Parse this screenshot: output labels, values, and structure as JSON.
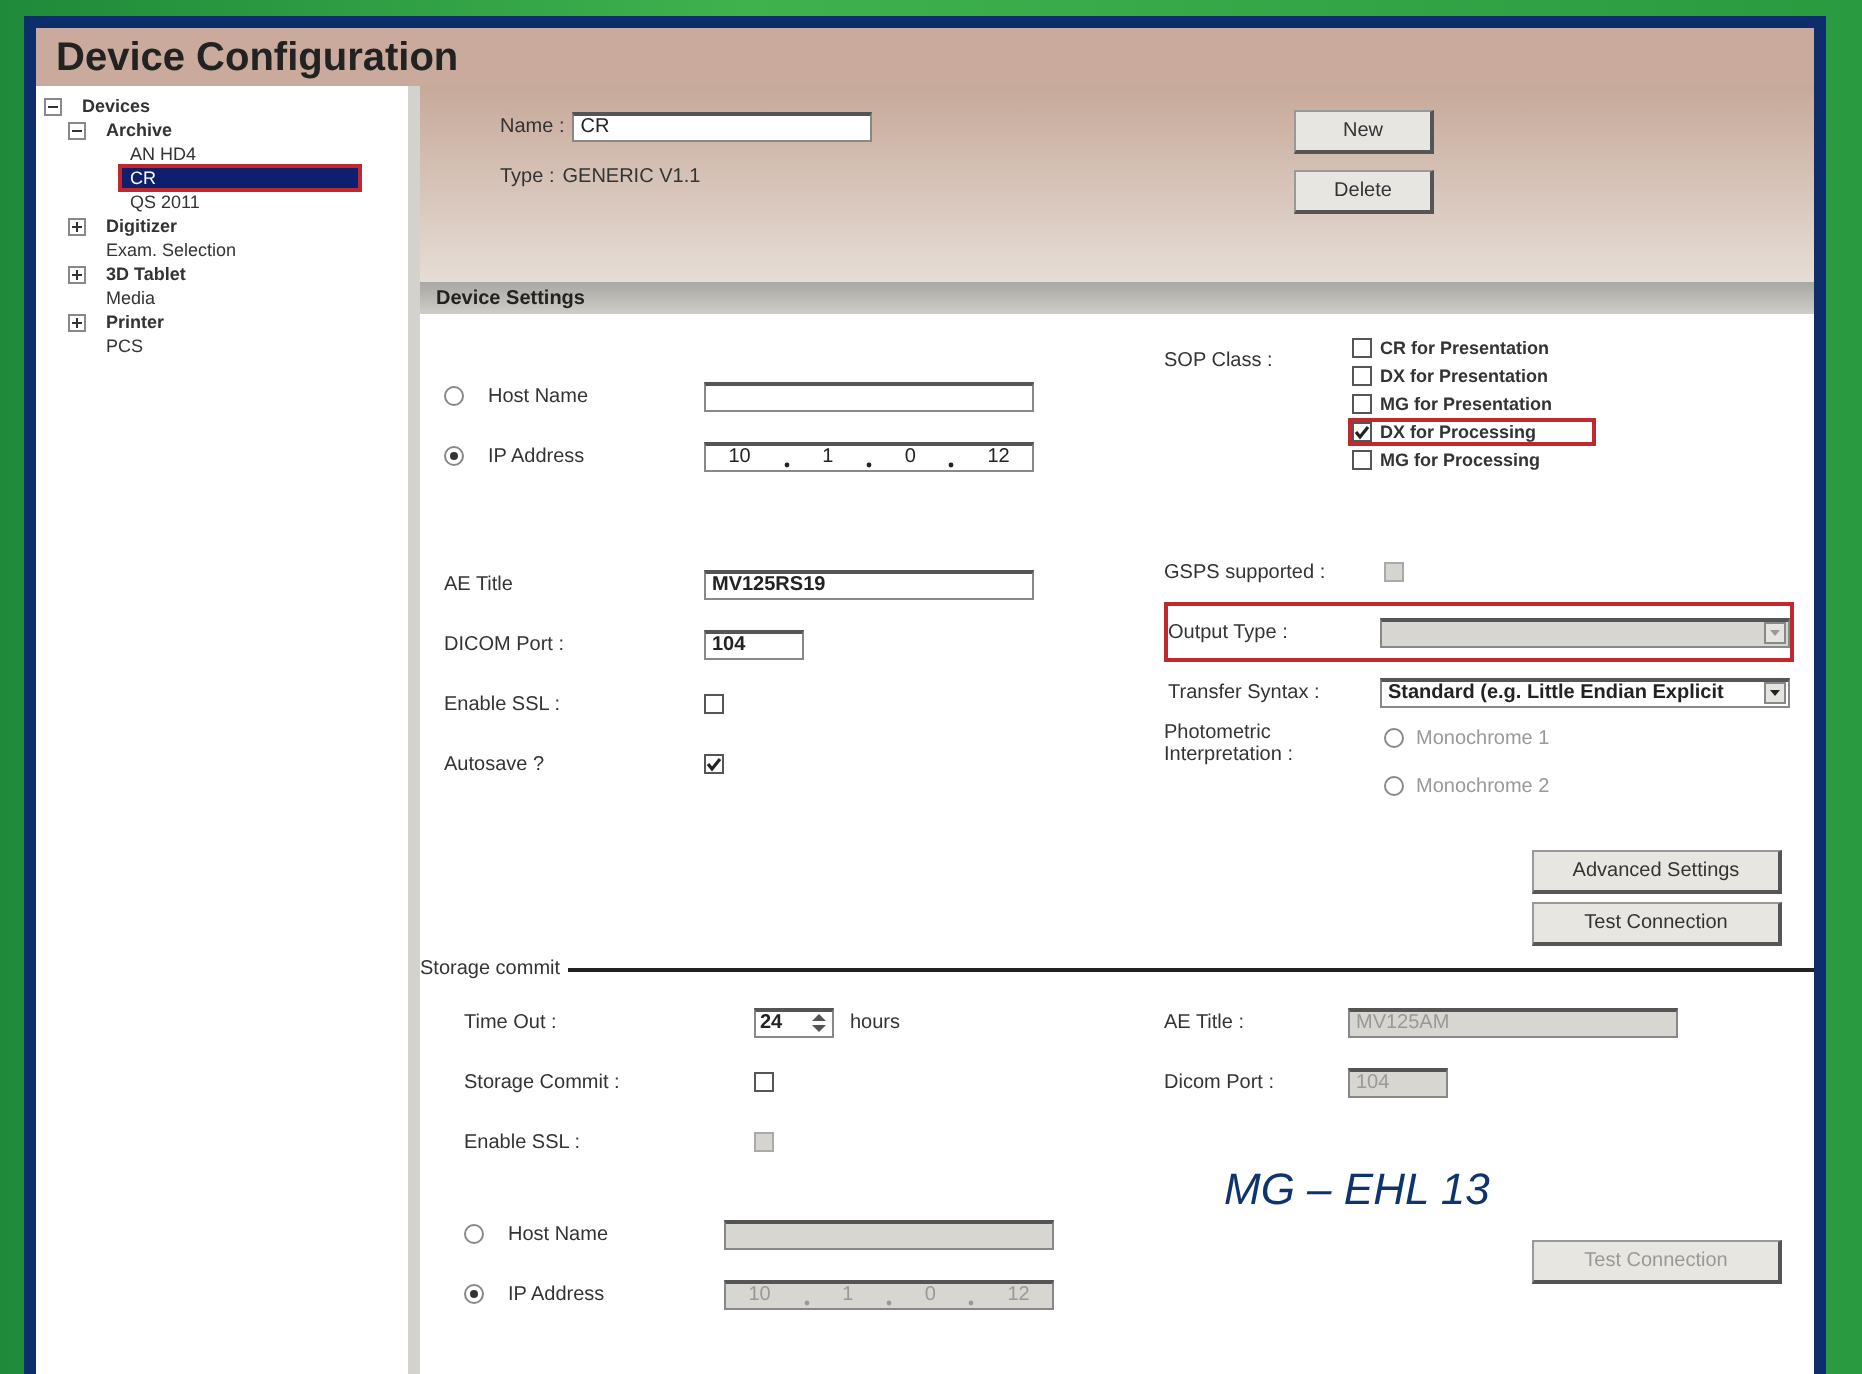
{
  "window": {
    "title": "Device Configuration"
  },
  "tree": [
    {
      "label": "Devices",
      "expanded": true,
      "selected": false,
      "children": [
        {
          "label": "Archive",
          "expanded": true,
          "selected": false,
          "children": [
            {
              "label": "AN HD4",
              "selected": false
            },
            {
              "label": "CR",
              "selected": true,
              "highlighted": true
            },
            {
              "label": "QS 2011",
              "selected": false
            }
          ]
        },
        {
          "label": "Digitizer",
          "expanded": false,
          "selected": false
        },
        {
          "label": "Exam. Selection",
          "selected": false
        },
        {
          "label": "3D Tablet",
          "expanded": false,
          "selected": false
        },
        {
          "label": "Media",
          "selected": false
        },
        {
          "label": "Printer",
          "expanded": false,
          "selected": false
        },
        {
          "label": "PCS",
          "selected": false
        }
      ]
    }
  ],
  "device": {
    "name_label": "Name :",
    "name": "CR",
    "type_label": "Type :",
    "type": "GENERIC V1.1",
    "buttons": [
      "New",
      "Delete"
    ]
  },
  "settings": {
    "title": "Device Settings",
    "left": [
      {
        "kind": "radio-text",
        "label": "Host Name",
        "selected": false
      },
      {
        "kind": "radio-ip",
        "label": "IP Address",
        "selected": true,
        "octets": [
          "10",
          "1",
          "0",
          "12"
        ]
      },
      {
        "kind": "text",
        "label": "AE Title",
        "value": "MV125RS19",
        "wide": true
      },
      {
        "kind": "text",
        "label": "DICOM Port :",
        "value": "104",
        "wide": false
      },
      {
        "kind": "checkbox",
        "label": "Enable SSL :",
        "checked": false
      },
      {
        "kind": "checkbox",
        "label": "Autosave ?",
        "checked": true
      }
    ],
    "sop_label": "SOP Class :",
    "sop_options": [
      {
        "label": "CR for Presentation",
        "checked": false,
        "highlighted": false
      },
      {
        "label": "DX for Presentation",
        "checked": false,
        "highlighted": false
      },
      {
        "label": "MG for Presentation",
        "checked": false,
        "highlighted": false
      },
      {
        "label": "DX for Processing",
        "checked": true,
        "highlighted": true
      },
      {
        "label": "MG for Processing",
        "checked": false,
        "highlighted": false
      }
    ],
    "right": [
      {
        "kind": "checkbox",
        "label": "GSPS supported :",
        "checked": false,
        "disabled": true
      },
      {
        "kind": "select",
        "label": "Output Type :",
        "disabled": true,
        "highlighted": true
      },
      {
        "kind": "select",
        "label": "Transfer Syntax :",
        "value": "Standard (e.g. Little Endian Explicit",
        "disabled": false,
        "highlighted": false
      },
      {
        "kind": "radios",
        "label": "Photometric Interpretation :",
        "options": [
          {
            "label": "Monochrome 1",
            "selected": false
          },
          {
            "label": "Monochrome 2",
            "selected": false
          }
        ]
      }
    ],
    "buttons": [
      "Advanced Settings",
      "Test Connection"
    ]
  },
  "storage": {
    "title": "Storage commit",
    "left": [
      {
        "kind": "spinner",
        "label": "Time Out :",
        "value": "24",
        "unit": "hours"
      },
      {
        "kind": "checkbox",
        "label": "Storage Commit :",
        "checked": false,
        "disabled": false
      },
      {
        "kind": "checkbox",
        "label": "Enable SSL :",
        "checked": false,
        "disabled": true
      },
      {
        "kind": "radio-text",
        "label": "Host Name",
        "selected": false,
        "disabled": true
      },
      {
        "kind": "radio-ip",
        "label": "IP Address",
        "selected": true,
        "disabled": true,
        "octets": [
          "10",
          "1",
          "0",
          "12"
        ]
      }
    ],
    "right": [
      {
        "kind": "text",
        "label": "AE Title :",
        "value": "MV125AM",
        "wide": true,
        "disabled": true
      },
      {
        "kind": "text",
        "label": "Dicom Port :",
        "value": "104",
        "wide": false,
        "disabled": true
      }
    ],
    "caption": "MG – EHL 13",
    "button": {
      "label": "Test Connection",
      "disabled": true
    }
  }
}
